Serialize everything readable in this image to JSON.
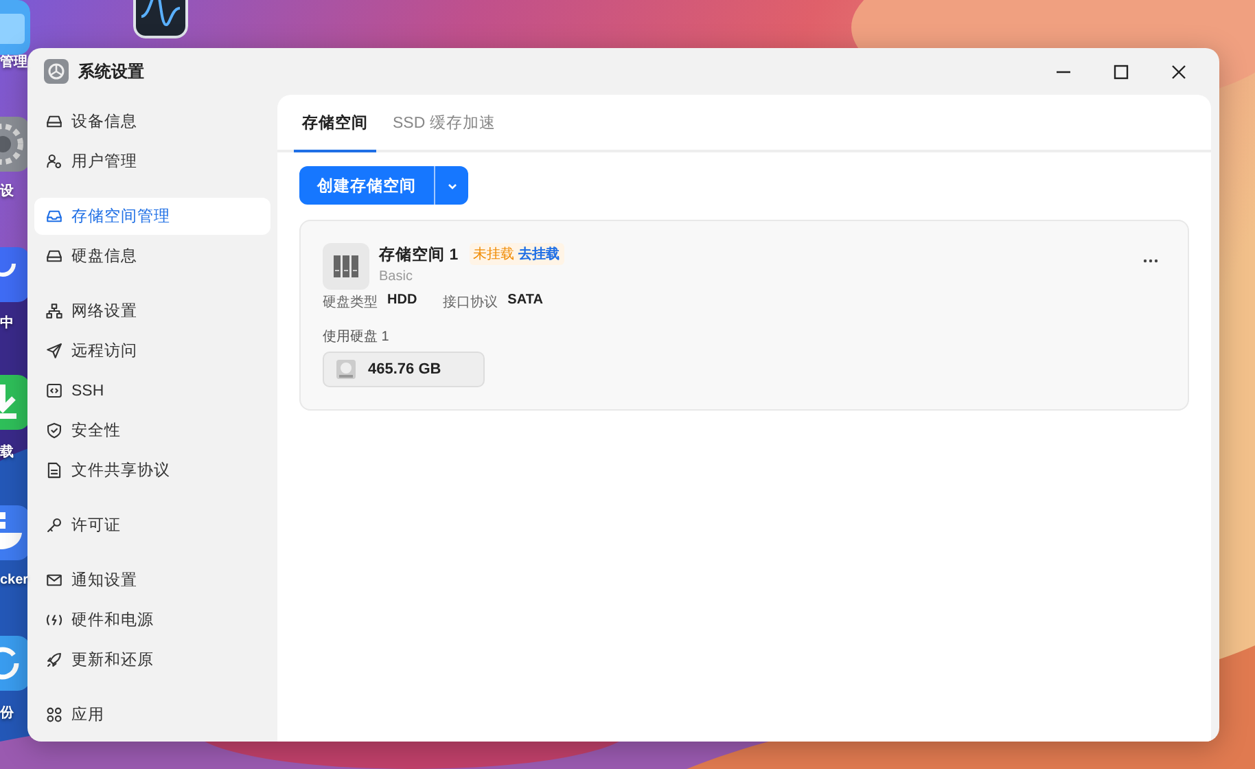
{
  "desktop": {
    "icons": [
      {
        "kind": "monitor"
      },
      {
        "kind": "folder",
        "label": "管理"
      },
      {
        "kind": "gear",
        "label": "设"
      },
      {
        "kind": "store",
        "label": "中"
      },
      {
        "kind": "download",
        "label": "载"
      },
      {
        "kind": "docker",
        "label": "cker"
      },
      {
        "kind": "backup",
        "label": "份"
      }
    ]
  },
  "window": {
    "title": "系统设置"
  },
  "sidebar": {
    "groups": [
      [
        {
          "label": "设备信息",
          "selected": false
        },
        {
          "label": "用户管理",
          "selected": false
        }
      ],
      [
        {
          "label": "存储空间管理",
          "selected": true
        },
        {
          "label": "硬盘信息",
          "selected": false
        }
      ],
      [
        {
          "label": "网络设置",
          "selected": false
        },
        {
          "label": "远程访问",
          "selected": false
        },
        {
          "label": "SSH",
          "selected": false
        },
        {
          "label": "安全性",
          "selected": false
        },
        {
          "label": "文件共享协议",
          "selected": false
        }
      ],
      [
        {
          "label": "许可证",
          "selected": false
        }
      ],
      [
        {
          "label": "通知设置",
          "selected": false
        },
        {
          "label": "硬件和电源",
          "selected": false
        },
        {
          "label": "更新和还原",
          "selected": false
        }
      ],
      [
        {
          "label": "应用",
          "selected": false
        }
      ]
    ]
  },
  "tabs": [
    {
      "label": "存储空间",
      "selected": true
    },
    {
      "label": "SSD 缓存加速",
      "selected": false
    }
  ],
  "create_button": {
    "label": "创建存储空间"
  },
  "pools": [
    {
      "name": "存储空间 1",
      "status": "未挂载",
      "action": "去挂载",
      "raid": "Basic",
      "disk_type_label": "硬盘类型",
      "disk_type": "HDD",
      "interface_label": "接口协议",
      "interface": "SATA",
      "disks_label": "使用硬盘 1",
      "disks": [
        {
          "size": "465.76 GB"
        }
      ]
    }
  ]
}
